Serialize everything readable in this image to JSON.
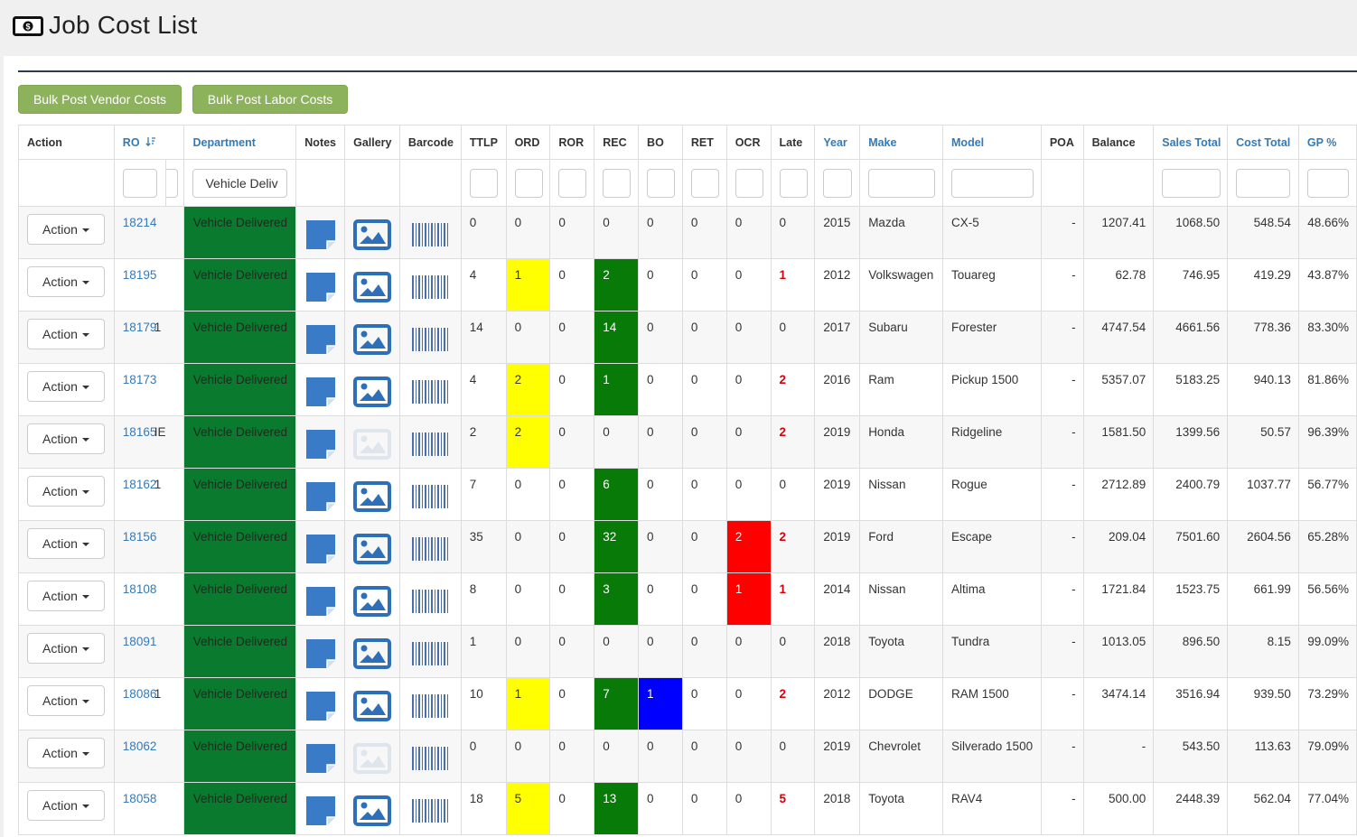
{
  "page": {
    "title": "Job Cost List",
    "icon": "money-icon"
  },
  "buttons": {
    "bulk_vendor": "Bulk Post Vendor Costs",
    "bulk_labor": "Bulk Post Labor Costs"
  },
  "columns": {
    "action": "Action",
    "ro": "RO",
    "department": "Department",
    "notes": "Notes",
    "gallery": "Gallery",
    "barcode": "Barcode",
    "ttlp": "TTLP",
    "ord": "ORD",
    "ror": "ROR",
    "rec": "REC",
    "bo": "BO",
    "ret": "RET",
    "ocr": "OCR",
    "late": "Late",
    "year": "Year",
    "make": "Make",
    "model": "Model",
    "poa": "POA",
    "balance": "Balance",
    "sales_total": "Sales Total",
    "cost_total": "Cost Total",
    "gp": "GP %"
  },
  "filters": {
    "department_value": "Vehicle Deliv"
  },
  "action_label": "Action",
  "rows": [
    {
      "ro": "18214",
      "ro_suffix": "",
      "dept": "Vehicle Delivered",
      "gallery": "active",
      "ttlp": "0",
      "ord": "0",
      "ror": "0",
      "rec": "0",
      "bo": "0",
      "ret": "0",
      "ocr": "0",
      "late": "0",
      "year": "2015",
      "make": "Mazda",
      "model": "CX-5",
      "poa": "-",
      "balance": "1207.41",
      "sales": "1068.50",
      "cost": "548.54",
      "gp": "48.66%"
    },
    {
      "ro": "18195",
      "ro_suffix": "",
      "dept": "Vehicle Delivered",
      "gallery": "active",
      "ttlp": "4",
      "ord": "1",
      "ror": "0",
      "rec": "2",
      "bo": "0",
      "ret": "0",
      "ocr": "0",
      "late": "1",
      "year": "2012",
      "make": "Volkswagen",
      "model": "Touareg",
      "poa": "-",
      "balance": "62.78",
      "sales": "746.95",
      "cost": "419.29",
      "gp": "43.87%"
    },
    {
      "ro": "18179",
      "ro_suffix": "1",
      "dept": "Vehicle Delivered",
      "gallery": "active",
      "ttlp": "14",
      "ord": "0",
      "ror": "0",
      "rec": "14",
      "bo": "0",
      "ret": "0",
      "ocr": "0",
      "late": "0",
      "year": "2017",
      "make": "Subaru",
      "model": "Forester",
      "poa": "-",
      "balance": "4747.54",
      "sales": "4661.56",
      "cost": "778.36",
      "gp": "83.30%"
    },
    {
      "ro": "18173",
      "ro_suffix": "",
      "dept": "Vehicle Delivered",
      "gallery": "active",
      "ttlp": "4",
      "ord": "2",
      "ror": "0",
      "rec": "1",
      "bo": "0",
      "ret": "0",
      "ocr": "0",
      "late": "2",
      "year": "2016",
      "make": "Ram",
      "model": "Pickup 1500",
      "poa": "-",
      "balance": "5357.07",
      "sales": "5183.25",
      "cost": "940.13",
      "gp": "81.86%"
    },
    {
      "ro": "18165",
      "ro_suffix": "IE",
      "dept": "Vehicle Delivered",
      "gallery": "inactive",
      "ttlp": "2",
      "ord": "2",
      "ror": "0",
      "rec": "0",
      "bo": "0",
      "ret": "0",
      "ocr": "0",
      "late": "2",
      "year": "2019",
      "make": "Honda",
      "model": "Ridgeline",
      "poa": "-",
      "balance": "1581.50",
      "sales": "1399.56",
      "cost": "50.57",
      "gp": "96.39%"
    },
    {
      "ro": "18162",
      "ro_suffix": "1",
      "dept": "Vehicle Delivered",
      "gallery": "active",
      "ttlp": "7",
      "ord": "0",
      "ror": "0",
      "rec": "6",
      "bo": "0",
      "ret": "0",
      "ocr": "0",
      "late": "0",
      "year": "2019",
      "make": "Nissan",
      "model": "Rogue",
      "poa": "-",
      "balance": "2712.89",
      "sales": "2400.79",
      "cost": "1037.77",
      "gp": "56.77%"
    },
    {
      "ro": "18156",
      "ro_suffix": "",
      "dept": "Vehicle Delivered",
      "gallery": "active",
      "ttlp": "35",
      "ord": "0",
      "ror": "0",
      "rec": "32",
      "bo": "0",
      "ret": "0",
      "ocr": "2",
      "late": "2",
      "year": "2019",
      "make": "Ford",
      "model": "Escape",
      "poa": "-",
      "balance": "209.04",
      "sales": "7501.60",
      "cost": "2604.56",
      "gp": "65.28%"
    },
    {
      "ro": "18108",
      "ro_suffix": "",
      "dept": "Vehicle Delivered",
      "gallery": "active",
      "ttlp": "8",
      "ord": "0",
      "ror": "0",
      "rec": "3",
      "bo": "0",
      "ret": "0",
      "ocr": "1",
      "late": "1",
      "year": "2014",
      "make": "Nissan",
      "model": "Altima",
      "poa": "-",
      "balance": "1721.84",
      "sales": "1523.75",
      "cost": "661.99",
      "gp": "56.56%"
    },
    {
      "ro": "18091",
      "ro_suffix": "",
      "dept": "Vehicle Delivered",
      "gallery": "active",
      "ttlp": "1",
      "ord": "0",
      "ror": "0",
      "rec": "0",
      "bo": "0",
      "ret": "0",
      "ocr": "0",
      "late": "0",
      "year": "2018",
      "make": "Toyota",
      "model": "Tundra",
      "poa": "-",
      "balance": "1013.05",
      "sales": "896.50",
      "cost": "8.15",
      "gp": "99.09%"
    },
    {
      "ro": "18086",
      "ro_suffix": "1",
      "dept": "Vehicle Delivered",
      "gallery": "active",
      "ttlp": "10",
      "ord": "1",
      "ror": "0",
      "rec": "7",
      "bo": "1",
      "ret": "0",
      "ocr": "0",
      "late": "2",
      "year": "2012",
      "make": "DODGE",
      "model": "RAM 1500",
      "poa": "-",
      "balance": "3474.14",
      "sales": "3516.94",
      "cost": "939.50",
      "gp": "73.29%"
    },
    {
      "ro": "18062",
      "ro_suffix": "",
      "dept": "Vehicle Delivered",
      "gallery": "inactive",
      "ttlp": "0",
      "ord": "0",
      "ror": "0",
      "rec": "0",
      "bo": "0",
      "ret": "0",
      "ocr": "0",
      "late": "0",
      "year": "2019",
      "make": "Chevrolet",
      "model": "Silverado 1500",
      "poa": "-",
      "balance": "-",
      "sales": "543.50",
      "cost": "113.63",
      "gp": "79.09%"
    },
    {
      "ro": "18058",
      "ro_suffix": "",
      "dept": "Vehicle Delivered",
      "gallery": "active",
      "ttlp": "18",
      "ord": "5",
      "ror": "0",
      "rec": "13",
      "bo": "0",
      "ret": "0",
      "ocr": "0",
      "late": "5",
      "year": "2018",
      "make": "Toyota",
      "model": "RAV4",
      "poa": "-",
      "balance": "500.00",
      "sales": "2448.39",
      "cost": "562.04",
      "gp": "77.04%"
    }
  ],
  "colors": {
    "highlight_yellow": "#ffff00",
    "highlight_green": "#087a08",
    "highlight_blue": "#0000ff",
    "highlight_red": "#ff0000",
    "department_bg": "#0a7a2f",
    "button_green": "#8cb25b",
    "link_blue": "#337ab7"
  }
}
